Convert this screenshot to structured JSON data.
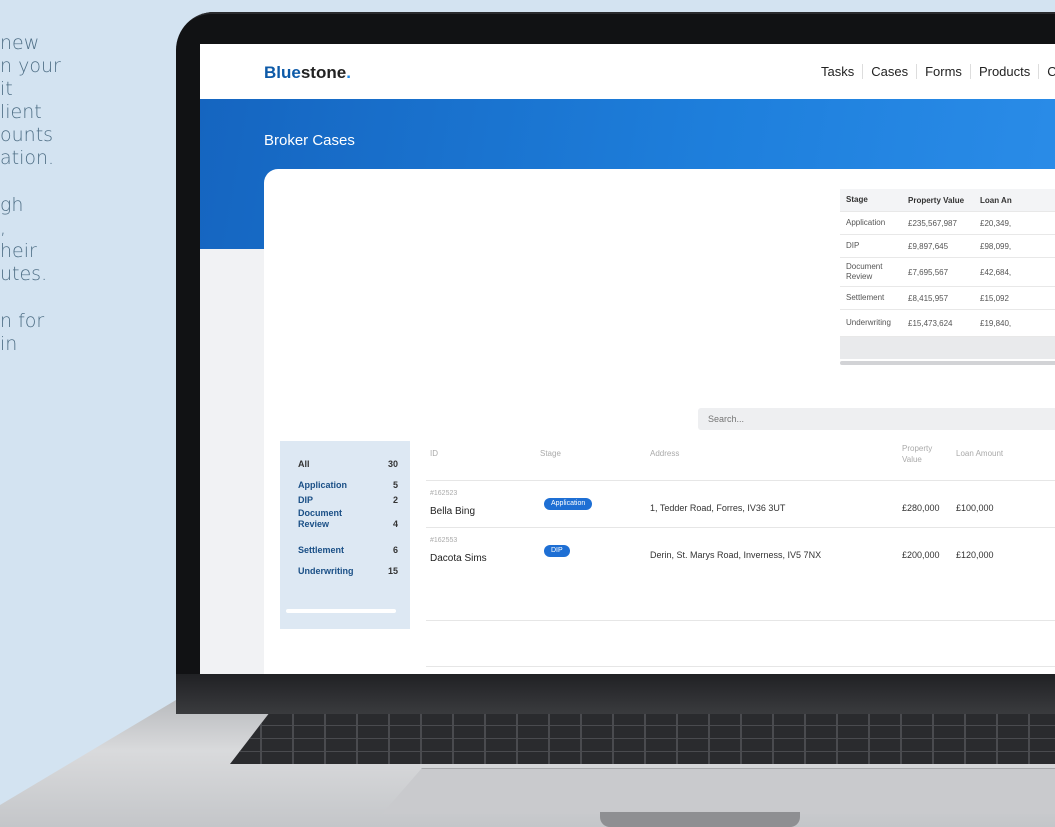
{
  "side_copy": [
    "new\nn your\nit\nlient\nounts\nation.",
    "gh\n,\nheir\nutes.",
    "n for\nin"
  ],
  "app": {
    "logo_prefix": "Blue",
    "logo_main": "stone",
    "logo_dot": ".",
    "nav": [
      "Tasks",
      "Cases",
      "Forms",
      "Products",
      "Case"
    ],
    "page_title": "Broker Cases"
  },
  "summary": {
    "headers": [
      "Stage",
      "Property Value",
      "Loan An"
    ],
    "rows": [
      {
        "stage": "Application",
        "property_value": "£235,567,987",
        "loan_amount": "£20,349,"
      },
      {
        "stage": "DIP",
        "property_value": "£9,897,645",
        "loan_amount": "£98,099,"
      },
      {
        "stage": "Document Review",
        "property_value": "£7,695,567",
        "loan_amount": "£42,684,"
      },
      {
        "stage": "Settlement",
        "property_value": "£8,415,957",
        "loan_amount": "£15,092"
      },
      {
        "stage": "Underwriting",
        "property_value": "£15,473,624",
        "loan_amount": "£19,840,"
      }
    ]
  },
  "search": {
    "placeholder": "Search..."
  },
  "filters": [
    {
      "label": "All",
      "count": "30"
    },
    {
      "label": "Application",
      "count": "5"
    },
    {
      "label": "DIP",
      "count": "2"
    },
    {
      "label": "Document Review",
      "count": "4"
    },
    {
      "label": "Settlement",
      "count": "6"
    },
    {
      "label": "Underwriting",
      "count": "15"
    }
  ],
  "list": {
    "headers": {
      "id": "ID",
      "stage": "Stage",
      "address": "Address",
      "property_value": "Property Value",
      "loan_amount": "Loan Amount"
    },
    "cases": [
      {
        "id": "#162523",
        "name": "Bella Bing",
        "stage": "Application",
        "address": "1, Tedder Road, Forres, IV36 3UT",
        "property_value": "£280,000",
        "loan_amount": "£100,000"
      },
      {
        "id": "#162553",
        "name": "Dacota Sims",
        "stage": "DIP",
        "address": "Derin, St. Marys Road, Inverness, IV5 7NX",
        "property_value": "£200,000",
        "loan_amount": "£120,000"
      }
    ]
  },
  "colors": {
    "brand": "#0d5aa8",
    "hero": "#1e7fdc",
    "pill": "#1e6fd4",
    "filter_bg": "#dde8f3"
  }
}
